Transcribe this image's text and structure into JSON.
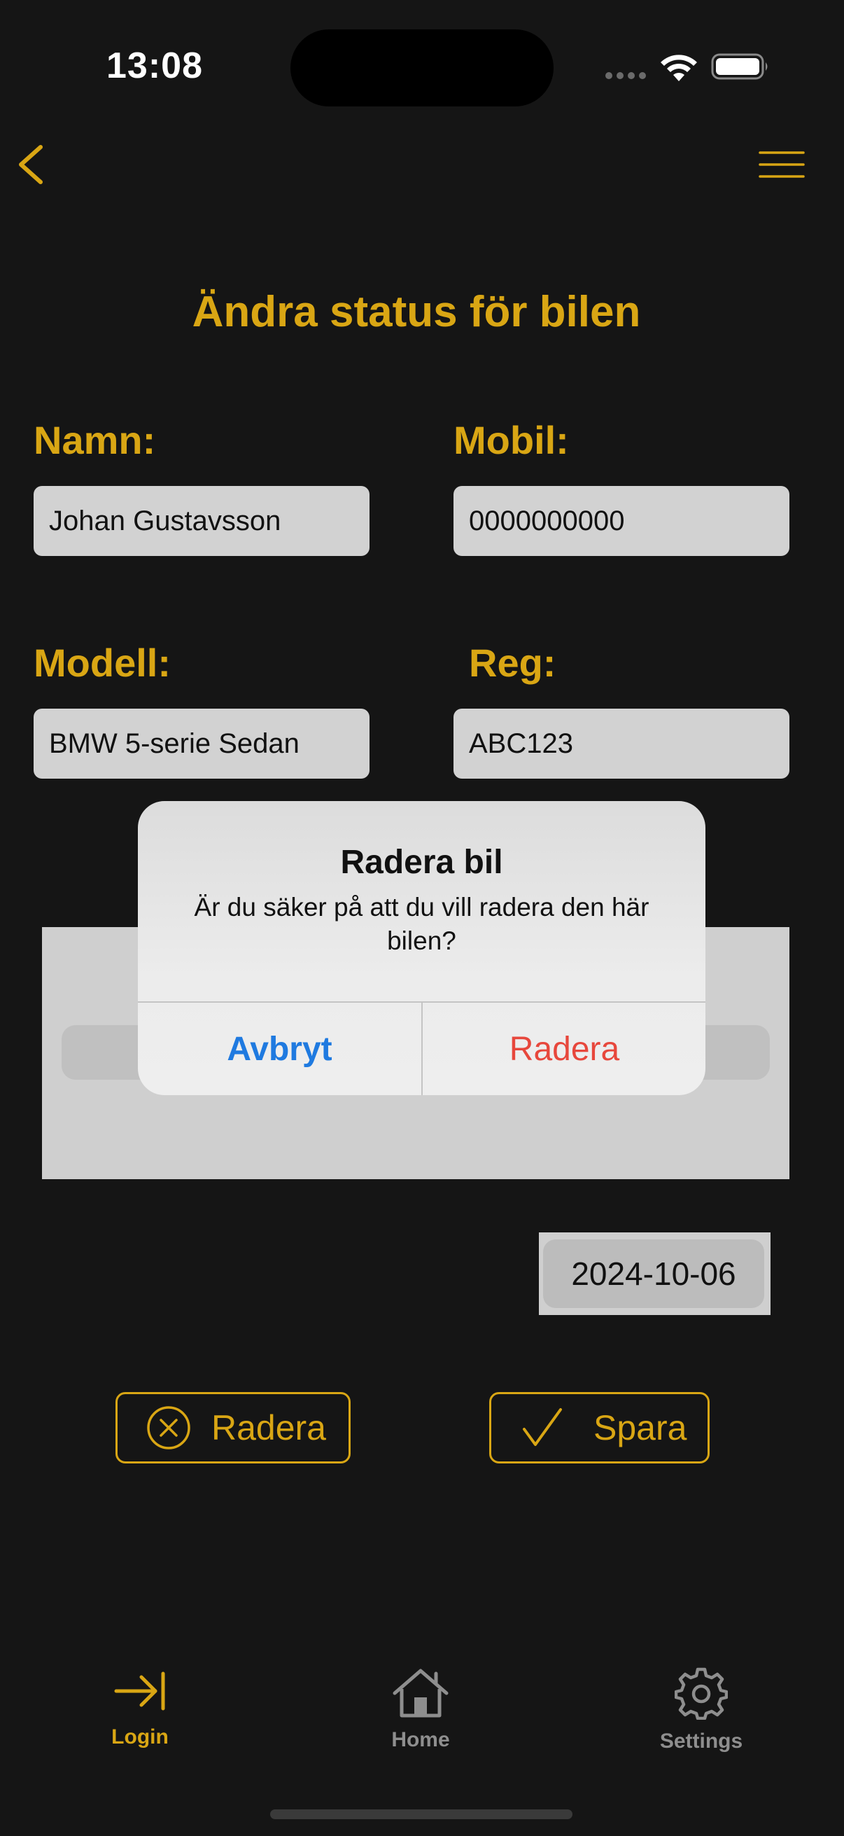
{
  "status_bar": {
    "time": "13:08"
  },
  "page": {
    "title": "Ändra status för bilen"
  },
  "form": {
    "name_label": "Namn:",
    "name_value": "Johan Gustavsson",
    "mobile_label": "Mobil:",
    "mobile_value": "0000000000",
    "model_label": "Modell:",
    "model_value": "BMW 5-serie Sedan",
    "reg_label": "Reg:",
    "reg_value": "ABC123",
    "date_value": "2024-10-06"
  },
  "actions": {
    "delete_label": "Radera",
    "save_label": "Spara"
  },
  "alert": {
    "title": "Radera bil",
    "message": "Är du säker på att du vill radera den här bilen?",
    "cancel_label": "Avbryt",
    "confirm_label": "Radera"
  },
  "tabs": [
    {
      "label": "Login",
      "icon": "login-icon",
      "active": true
    },
    {
      "label": "Home",
      "icon": "home-icon",
      "active": false
    },
    {
      "label": "Settings",
      "icon": "gear-icon",
      "active": false
    }
  ],
  "colors": {
    "background": "#151515",
    "accent": "#d9a614",
    "field": "#d2d2d2",
    "alert_cancel": "#1f7ae0",
    "alert_destructive": "#e7473c",
    "tab_inactive": "#8e8e8e"
  }
}
